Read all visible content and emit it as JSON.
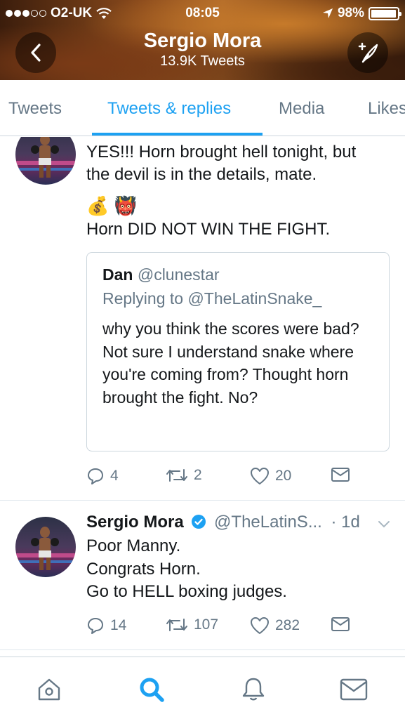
{
  "status_bar": {
    "carrier": "O2-UK",
    "time": "08:05",
    "battery_percent": "98%",
    "battery_level": 0.98
  },
  "header": {
    "name": "Sergio Mora",
    "tweet_count": "13.9K Tweets"
  },
  "tabs": [
    {
      "label": "Tweets",
      "active": false
    },
    {
      "label": "Tweets & replies",
      "active": true
    },
    {
      "label": "Media",
      "active": false
    },
    {
      "label": "Likes",
      "active": false
    }
  ],
  "tweet1": {
    "text_line1": "YES!!! Horn brought hell tonight, but",
    "text_line2": "the devil is in the details, mate.",
    "emoji": "💰 👹",
    "text_line3": "Horn DID NOT WIN THE FIGHT.",
    "quote": {
      "name": "Dan",
      "handle": "@clunestar",
      "replying_to": "Replying to @TheLatinSnake_",
      "body": "why you think the scores were bad? Not sure I understand snake where you're coming from? Thought horn brought the fight. No?"
    },
    "replies": "4",
    "retweets": "2",
    "likes": "20"
  },
  "tweet2": {
    "name": "Sergio Mora",
    "handle": "@TheLatinS...",
    "time": "· 1d",
    "line1": "Poor Manny.",
    "line2": "Congrats Horn.",
    "line3": "Go to HELL boxing judges.",
    "replies": "14",
    "retweets": "107",
    "likes": "282"
  },
  "colors": {
    "accent": "#1da1f2",
    "secondary_text": "#657786",
    "border": "#ccd6dd"
  }
}
